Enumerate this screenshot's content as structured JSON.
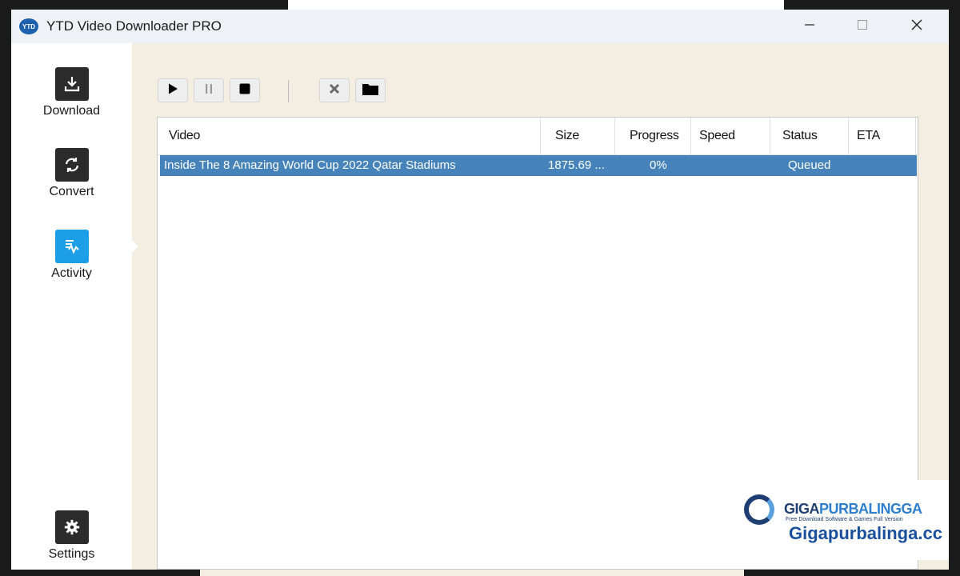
{
  "window": {
    "title": "YTD Video Downloader PRO",
    "logo_text": "YTD",
    "minimize_icon": "minimize-icon",
    "maximize_icon": "maximize-icon",
    "close_icon": "close-icon"
  },
  "sidebar": {
    "items": [
      {
        "label": "Download",
        "icon": "download-icon",
        "active": false
      },
      {
        "label": "Convert",
        "icon": "convert-icon",
        "active": false
      },
      {
        "label": "Activity",
        "icon": "activity-icon",
        "active": true
      },
      {
        "label": "Settings",
        "icon": "gear-icon",
        "active": false
      }
    ]
  },
  "toolbar": {
    "buttons": [
      "play-icon",
      "pause-icon",
      "stop-icon",
      "remove-icon",
      "folder-icon"
    ]
  },
  "table": {
    "columns": [
      "Video",
      "Size",
      "Progress",
      "Speed",
      "Status",
      "ETA"
    ],
    "rows": [
      {
        "video": "Inside The 8 Amazing World Cup 2022 Qatar Stadiums",
        "size": "1875.69 ...",
        "progress": "0%",
        "speed": "",
        "status": "Queued",
        "eta": "",
        "selected": true
      }
    ]
  },
  "watermark": {
    "brand_giga": "GIGA",
    "brand_rest": "PURBALINGGA",
    "tagline": "Free Download Software & Games Full Version",
    "site": "Gigapurbalinga.cc"
  },
  "colors": {
    "accent": "#4683bb",
    "active_nav": "#1c9fe6",
    "nav_icon_bg": "#2b2b2b",
    "content_bg": "#f3ede2"
  }
}
